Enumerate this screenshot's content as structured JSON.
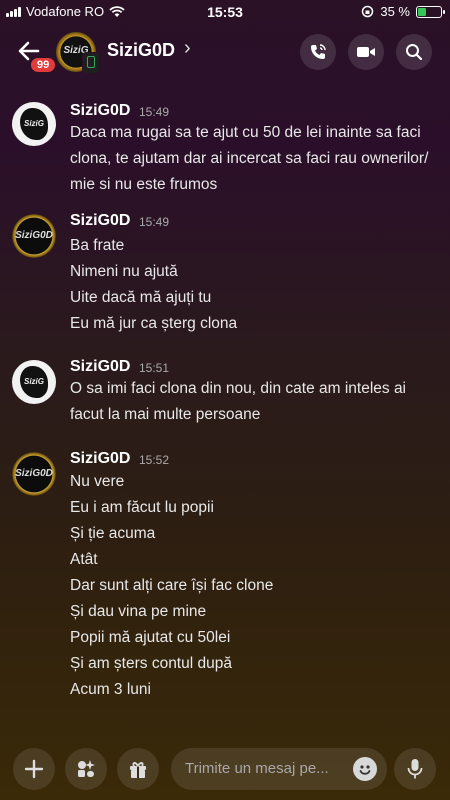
{
  "status": {
    "carrier": "Vodafone RO",
    "time": "15:53",
    "battery_percent": "35 %",
    "battery_level": 0.35
  },
  "header": {
    "unread_badge": "99",
    "channel_name": "SiziG0D",
    "icons": [
      "back-arrow-icon",
      "voice-call-icon",
      "video-call-icon",
      "search-icon"
    ]
  },
  "messages": [
    {
      "author": "SiziG0D",
      "time": "15:49",
      "avatar": "white",
      "lines": [
        "Daca ma rugai sa te ajut cu 50 de lei inainte sa faci clona, te ajutam dar ai incercat sa faci rau ownerilor/ mie si nu este frumos"
      ]
    },
    {
      "author": "SiziG0D",
      "time": "15:49",
      "avatar": "black",
      "lines": [
        "Ba frate",
        "Nimeni nu ajută",
        "Uite dacă mă ajuți tu",
        "Eu mă jur ca șterg clona"
      ]
    },
    {
      "author": "SiziG0D",
      "time": "15:51",
      "avatar": "white",
      "lines": [
        "O sa imi faci clona din nou, din cate am inteles ai facut la mai multe persoane"
      ]
    },
    {
      "author": "SiziG0D",
      "time": "15:52",
      "avatar": "black",
      "lines": [
        "Nu vere",
        "Eu i am făcut lu popii",
        "Și ție acuma",
        "Atât",
        "Dar sunt alți care își fac clone",
        "Și dau vina pe mine",
        "Popii mă ajutat cu 50lei",
        "Și am șters contul după",
        "Acum 3 luni"
      ]
    }
  ],
  "composer": {
    "placeholder": "Trimite un mesaj pe...",
    "icons": [
      "plus-icon",
      "apps-icon",
      "gift-icon",
      "emoji-icon",
      "microphone-icon"
    ]
  }
}
